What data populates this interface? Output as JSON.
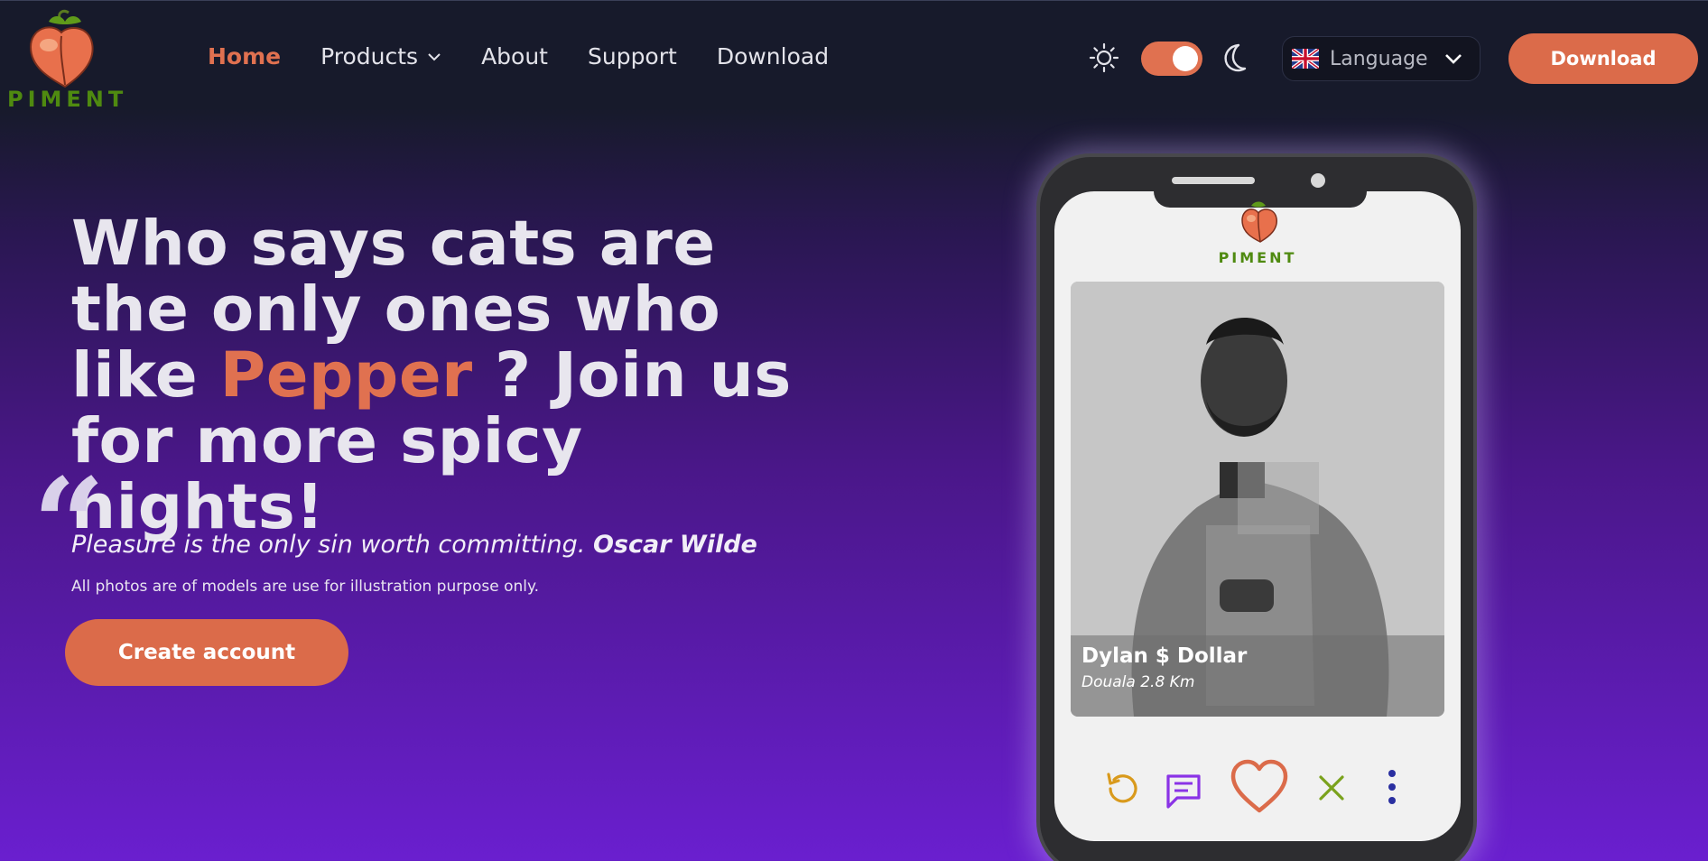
{
  "brand": {
    "name": "PIMENT"
  },
  "nav": {
    "items": [
      {
        "label": "Home",
        "active": true
      },
      {
        "label": "Products",
        "has_dropdown": true
      },
      {
        "label": "About"
      },
      {
        "label": "Support"
      },
      {
        "label": "Download"
      }
    ]
  },
  "header": {
    "theme_toggle": {
      "state": "dark",
      "light_icon": "sun-icon",
      "dark_icon": "moon-icon"
    },
    "language": {
      "label": "Language",
      "flag": "uk-flag-icon"
    },
    "download_label": "Download"
  },
  "hero": {
    "headline_part1": "Who says cats are the only ones who like",
    "headline_accent": "Pepper",
    "headline_part2": " ? Join us for more spicy nights!",
    "quote_text": "Pleasure is the only sin worth committing.",
    "quote_author": "Oscar Wilde",
    "disclaimer": "All photos are of models are use for illustration purpose only.",
    "cta_label": "Create account"
  },
  "phone": {
    "app_name": "PIMENT",
    "profile": {
      "name": "Dylan $ Dollar",
      "location": "Douala 2.8 Km"
    },
    "actions": [
      "undo-icon",
      "chat-icon",
      "heart-icon",
      "close-icon",
      "more-vertical-icon"
    ]
  },
  "colors": {
    "accent": "#db6b4a",
    "brand_green": "#4f8a10",
    "bg_dark": "#171a2b",
    "bg_purple": "#6a1fcf"
  }
}
